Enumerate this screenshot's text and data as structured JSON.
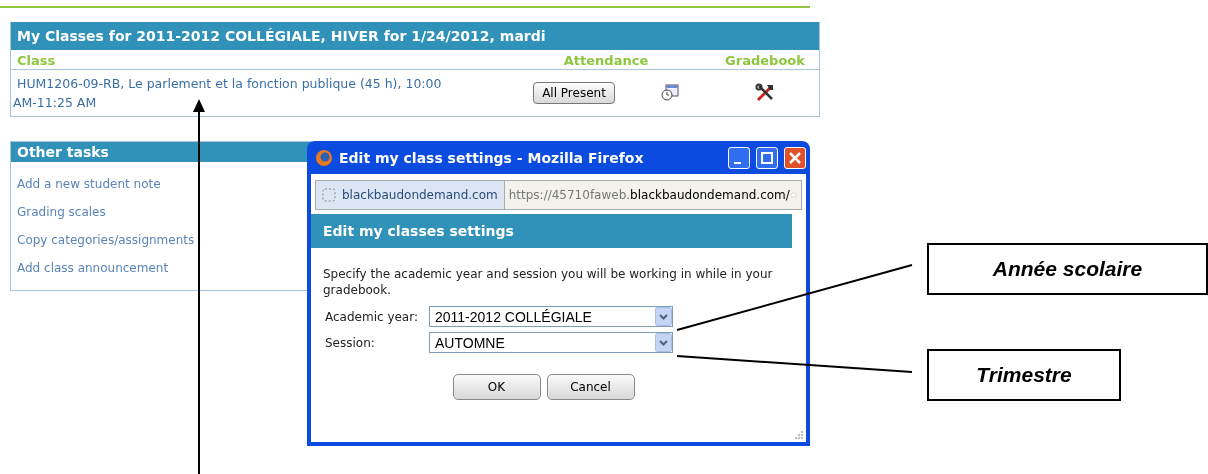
{
  "classes_panel": {
    "title": "My Classes for 2011-2012 COLLÉGIALE, HIVER for 1/24/2012, mardi",
    "columns": [
      "Class",
      "Attendance",
      "Gradebook"
    ],
    "rows": [
      {
        "class": "HUM1206-09-RB, Le parlement et la fonction publique (45 h), 10:00 AM-11:25 AM",
        "attendance_button": "All Present"
      }
    ]
  },
  "other_tasks": {
    "title": "Other tasks",
    "links": [
      "Add a new student note",
      "Grading scales",
      "Copy categories/assignments",
      "Add class announcement"
    ]
  },
  "dialog": {
    "title": "Edit my class settings - Mozilla Firefox",
    "site_identity": "blackbaudondemand.com",
    "url": "https://45710faweb.**blackbaudondemand.com/**",
    "heading": "Edit my classes settings",
    "instructions": "Specify the academic year and session you will be working in while in your gradebook.",
    "fields": [
      {
        "label": "Academic year:",
        "value": "2011-2012 COLLÉGIALE"
      },
      {
        "label": "Session:",
        "value": "AUTOMNE"
      }
    ],
    "buttons": [
      "OK",
      "Cancel"
    ]
  },
  "callouts": [
    {
      "text": "Année scolaire"
    },
    {
      "text": "Trimestre"
    }
  ]
}
